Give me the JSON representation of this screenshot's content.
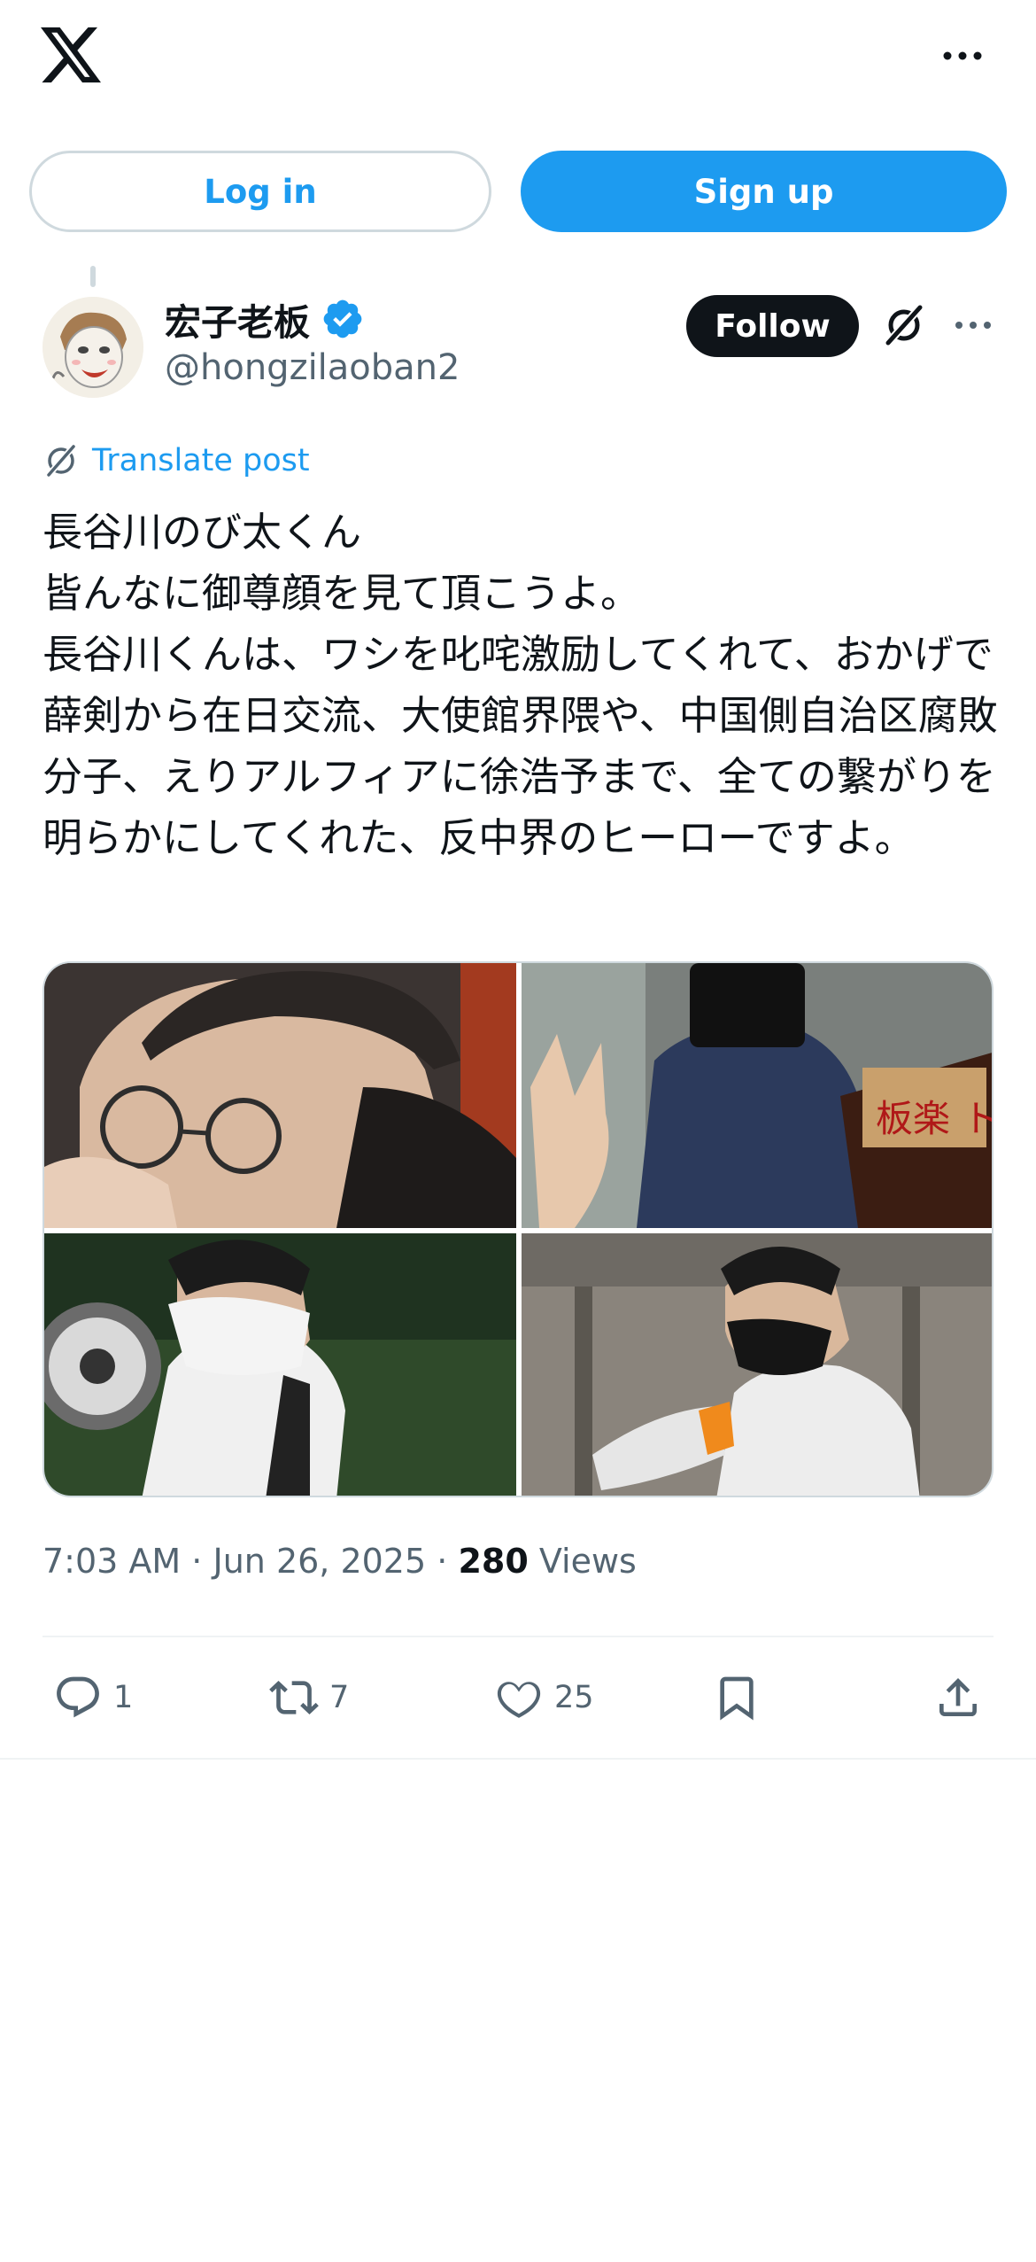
{
  "header": {
    "logo_icon": "x-logo-icon",
    "more_icon": "more-dots-icon"
  },
  "auth": {
    "login_label": "Log in",
    "signup_label": "Sign up"
  },
  "tweet": {
    "author": {
      "display_name": "宏子老板",
      "handle": "@hongzilaoban2",
      "verified": true,
      "verified_color": "#1d9bf0"
    },
    "follow_label": "Follow",
    "translate_label": "Translate post",
    "text": "長谷川のび太くん\n皆んなに御尊顔を見て頂こうよ。\n長谷川くんは、ワシを叱咤激励してくれて、おかげで薛剣から在日交流、大使館界隈や、中国側自治区腐敗分子、えりアルフィアに徐浩予まで、全ての繋がりを明らかにしてくれた、反中界のヒーローですよ。",
    "media": [
      {
        "sign_text": ""
      },
      {
        "sign_text": "板楽 トランス差"
      },
      {
        "sign_text": ""
      },
      {
        "sign_text": ""
      }
    ],
    "time": "7:03 AM",
    "date": "Jun 26, 2025",
    "views_count": "280",
    "views_label": "Views",
    "separator": "·",
    "actions": {
      "replies": "1",
      "reposts": "7",
      "likes": "25"
    }
  },
  "colors": {
    "accent": "#1d9bf0",
    "text_primary": "#0f1419",
    "text_secondary": "#536471",
    "border": "#cfd9de"
  }
}
